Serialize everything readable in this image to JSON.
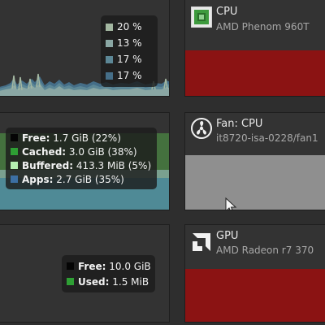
{
  "cpu_history": {
    "legend": [
      {
        "value": "20 %",
        "color": "#a3b7a1"
      },
      {
        "value": "13 %",
        "color": "#8aa7a4"
      },
      {
        "value": "17 %",
        "color": "#5c8796"
      },
      {
        "value": "17 %",
        "color": "#456e88"
      }
    ]
  },
  "memory": {
    "items": [
      {
        "label": "Free:",
        "value": "1.7 GiB (22%)",
        "color": "#050505"
      },
      {
        "label": "Cached:",
        "value": "3.0 GiB (38%)",
        "color": "#2e9f34"
      },
      {
        "label": "Buffered:",
        "value": "413.3 MiB (5%)",
        "color": "#b4efb1"
      },
      {
        "label": "Apps:",
        "value": "2.7 GiB (35%)",
        "color": "#3c6fa3"
      }
    ]
  },
  "swap": {
    "items": [
      {
        "label": "Free:",
        "value": "10.0 GiB",
        "color": "#050505"
      },
      {
        "label": "Used:",
        "value": "1.5 MiB",
        "color": "#2e9f34"
      }
    ]
  },
  "sensors": [
    {
      "title": "CPU",
      "subtitle": "AMD Phenom 960T",
      "icon": "chip-icon",
      "bar_color": "#8b1313"
    },
    {
      "title": "Fan: CPU",
      "subtitle": "it8720-isa-0228/fan1",
      "icon": "fan-icon",
      "bar_color": "#8f8f8f"
    },
    {
      "title": "GPU",
      "subtitle": "AMD Radeon r7 370",
      "icon": "amd-logo-icon",
      "bar_color": "#8b1313"
    }
  ]
}
